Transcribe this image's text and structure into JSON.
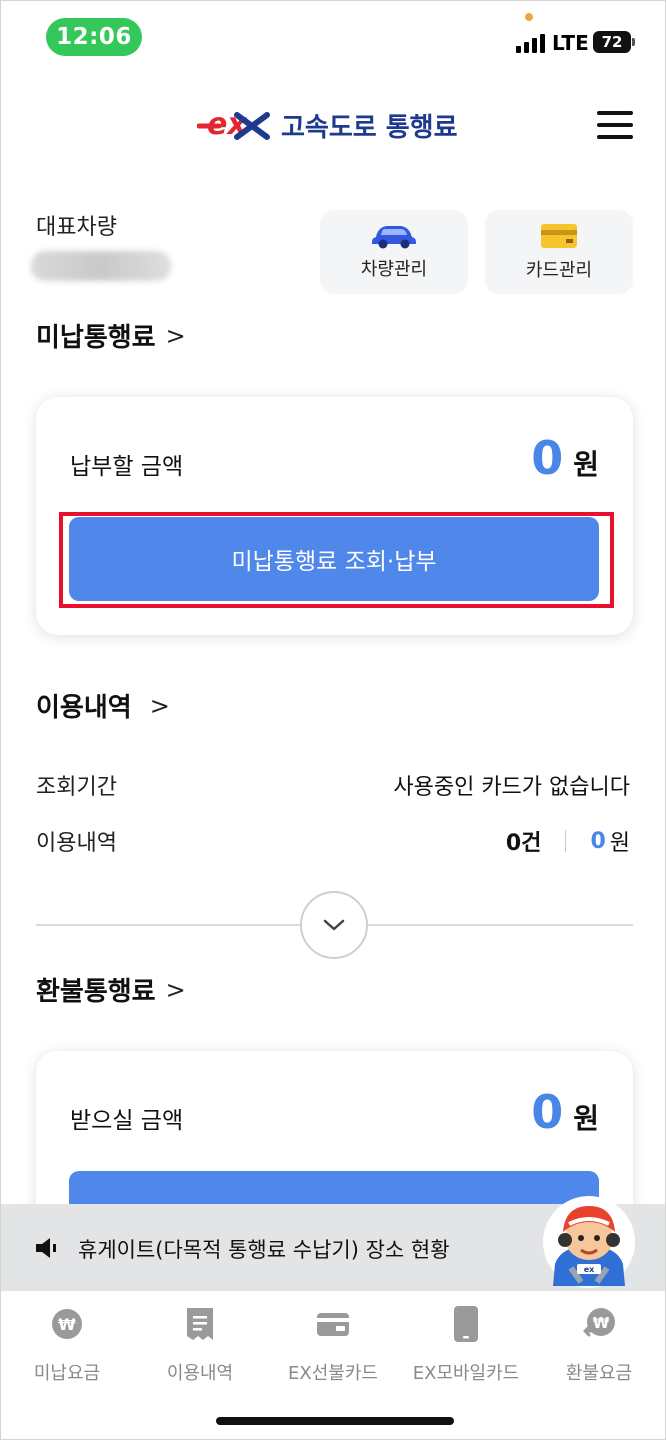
{
  "status_bar": {
    "time": "12:06",
    "network": "LTE",
    "battery": "72"
  },
  "header": {
    "logo_mark": "ex",
    "title": "고속도로 통행료",
    "menu_icon": "hamburger-menu-icon"
  },
  "vehicle": {
    "label": "대표차량",
    "quick_actions": [
      {
        "label": "차량관리",
        "icon": "car-icon"
      },
      {
        "label": "카드관리",
        "icon": "card-icon"
      }
    ]
  },
  "unpaid": {
    "title": "미납통행료",
    "amount_label": "납부할 금액",
    "amount": "0",
    "unit": "원",
    "button_label": "미납통행료 조회·납부"
  },
  "usage": {
    "title": "이용내역",
    "period_label": "조회기간",
    "period_value": "사용중인 카드가 없습니다",
    "history_label": "이용내역",
    "count": "0건",
    "amount": "0",
    "unit": "원"
  },
  "refund": {
    "title": "환불통행료",
    "amount_label": "받으실 금액",
    "amount": "0",
    "unit": "원"
  },
  "banner": {
    "text": "휴게이트(다목적 통행료 수납기) 장소 현황",
    "icon": "speaker-icon"
  },
  "bottom_nav": [
    {
      "label": "미납요금",
      "icon": "won-icon"
    },
    {
      "label": "이용내역",
      "icon": "receipt-icon"
    },
    {
      "label": "EX선불카드",
      "icon": "wallet-icon"
    },
    {
      "label": "EX모바일카드",
      "icon": "phone-icon"
    },
    {
      "label": "환불요금",
      "icon": "refund-won-icon"
    }
  ],
  "colors": {
    "accent": "#4f87ea",
    "amount": "#4a86e8",
    "highlight": "#e8112d",
    "brand": "#1d3a8f",
    "logo_red": "#e3262f"
  }
}
